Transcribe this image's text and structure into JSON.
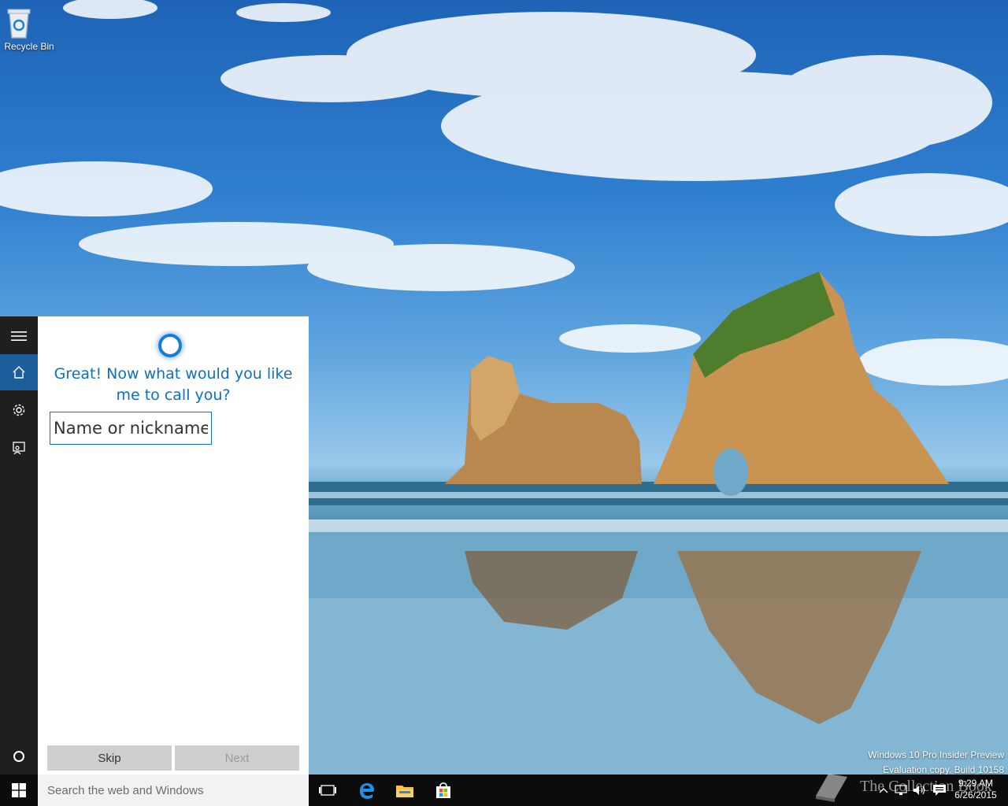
{
  "desktop": {
    "recycle_bin_label": "Recycle Bin",
    "watermark_line1": "Windows 10 Pro Insider Preview",
    "watermark_line2": "Evaluation copy. Build 10158"
  },
  "cortana": {
    "prompt": "Great! Now what would you like me to call you?",
    "name_placeholder": "Name or nickname",
    "skip_label": "Skip",
    "next_label": "Next",
    "rail_icons": [
      "hamburger-icon",
      "home-icon",
      "settings-icon",
      "feedback-icon",
      "cortana-circle-icon"
    ]
  },
  "taskbar": {
    "search_placeholder": "Search the web and Windows",
    "clock_time": "9:29 AM",
    "clock_date": "6/26/2015",
    "overlay_logo_text": "The Collection Book",
    "pinned_icons": [
      "task-view-icon",
      "edge-icon",
      "file-explorer-icon",
      "store-icon"
    ],
    "tray_icons": [
      "chevron-up-icon",
      "network-icon",
      "volume-icon",
      "action-center-icon"
    ]
  },
  "colors": {
    "accent": "#1a7bd4",
    "prompt_text": "#0e6fc1",
    "rail_bg": "#1f1f1f",
    "rail_active": "#1b5e9b",
    "taskbar_bg": "#0c0c0c"
  }
}
